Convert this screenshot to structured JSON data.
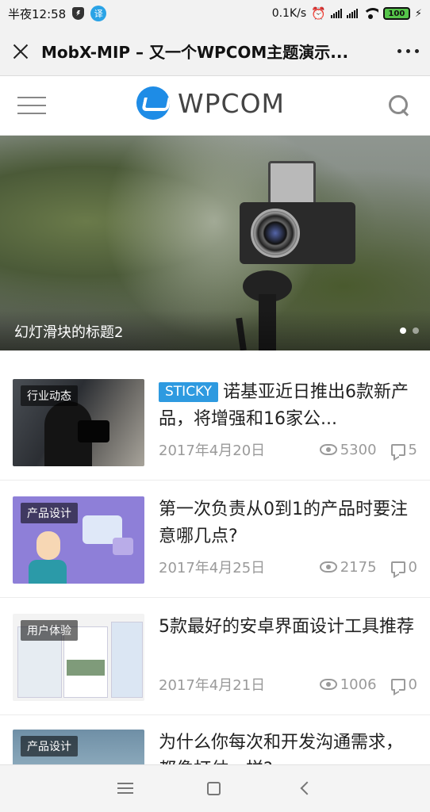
{
  "status_bar": {
    "time": "半夜12:58",
    "app_badge": "译",
    "net_speed": "0.1K/s",
    "battery": "100"
  },
  "titlebar": {
    "title": "MobX-MIP – 又一个WPCOM主题演示..."
  },
  "header": {
    "logo_text": "WPCOM"
  },
  "slider": {
    "title": "幻灯滑块的标题2",
    "dot_count": 2,
    "active_dot": 0
  },
  "posts": [
    {
      "category": "行业动态",
      "sticky": "STICKY",
      "title": "诺基亚近日推出6款新产品，将增强和16家公...",
      "date": "2017年4月20日",
      "views": "5300",
      "comments": "5"
    },
    {
      "category": "产品设计",
      "title": "第一次负责从0到1的产品时要注意哪几点?",
      "date": "2017年4月25日",
      "views": "2175",
      "comments": "0"
    },
    {
      "category": "用户体验",
      "title": "5款最好的安卓界面设计工具推荐",
      "date": "2017年4月21日",
      "views": "1006",
      "comments": "0"
    },
    {
      "category": "产品设计",
      "title": "为什么你每次和开发沟通需求，都像打仗一样?"
    }
  ],
  "colors": {
    "accent": "#2e9ae0",
    "logo": "#1e8ce6"
  }
}
